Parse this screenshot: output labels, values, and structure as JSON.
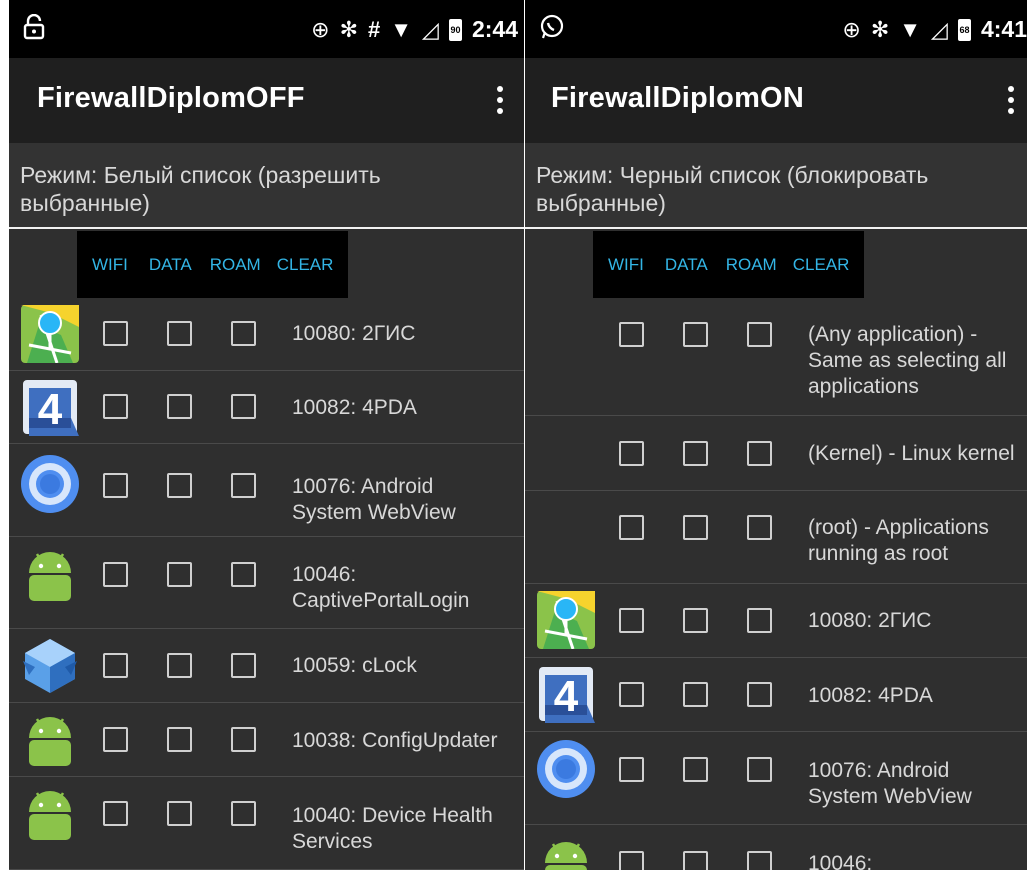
{
  "left": {
    "status": {
      "time": "2:44",
      "battery": "90"
    },
    "title": "FirewallDiplomOFF",
    "mode": "Режим: Белый список (разрешить выбранные)",
    "columns": [
      "WIFI",
      "DATA",
      "ROAM",
      "CLEAR"
    ],
    "apps": [
      {
        "label": "10080: 2ГИС",
        "icon": "2gis-icon"
      },
      {
        "label": "10082: 4PDA",
        "icon": "4pda-icon"
      },
      {
        "label": "10076: Android System WebView",
        "icon": "chrome-icon"
      },
      {
        "label": "10046: CaptivePortalLogin",
        "icon": "android-icon"
      },
      {
        "label": "10059: cLock",
        "icon": "clock-cube-icon"
      },
      {
        "label": "10038: ConfigUpdater",
        "icon": "android-icon"
      },
      {
        "label": "10040: Device Health Services",
        "icon": "android-icon"
      }
    ]
  },
  "right": {
    "status": {
      "time": "4:41",
      "battery": "68"
    },
    "title": "FirewallDiplomON",
    "mode": "Режим: Черный список (блокировать выбранные)",
    "columns": [
      "WIFI",
      "DATA",
      "ROAM",
      "CLEAR"
    ],
    "apps": [
      {
        "label": "(Any application) - Same as selecting all applications",
        "icon": ""
      },
      {
        "label": "(Kernel) - Linux kernel",
        "icon": ""
      },
      {
        "label": "(root) - Applications running as root",
        "icon": ""
      },
      {
        "label": "10080: 2ГИС",
        "icon": "2gis-icon"
      },
      {
        "label": "10082: 4PDA",
        "icon": "4pda-icon"
      },
      {
        "label": "10076: Android System WebView",
        "icon": "chrome-icon"
      },
      {
        "label": "10046:",
        "icon": "android-icon"
      }
    ]
  }
}
